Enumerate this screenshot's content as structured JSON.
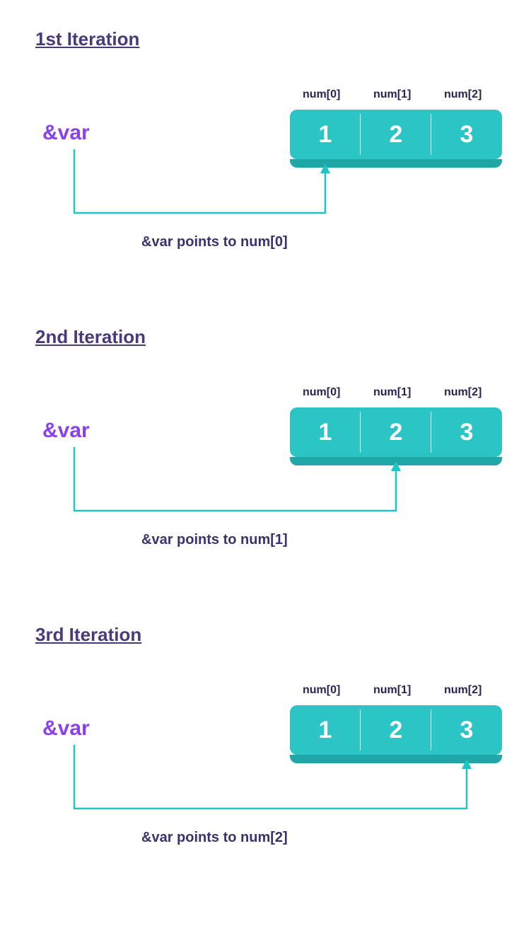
{
  "colors": {
    "accent": "#2bc5c5",
    "var": "#8a3ff0",
    "ink": "#3a3270"
  },
  "iterations": [
    {
      "title": "1st Iteration",
      "var_label": "&var",
      "cells": [
        {
          "label": "num[0]",
          "value": "1"
        },
        {
          "label": "num[1]",
          "value": "2"
        },
        {
          "label": "num[2]",
          "value": "3"
        }
      ],
      "caption": "&var points to num[0]",
      "target_index": 0
    },
    {
      "title": "2nd Iteration",
      "var_label": "&var",
      "cells": [
        {
          "label": "num[0]",
          "value": "1"
        },
        {
          "label": "num[1]",
          "value": "2"
        },
        {
          "label": "num[2]",
          "value": "3"
        }
      ],
      "caption": "&var points to num[1]",
      "target_index": 1
    },
    {
      "title": "3rd Iteration",
      "var_label": "&var",
      "cells": [
        {
          "label": "num[0]",
          "value": "1"
        },
        {
          "label": "num[1]",
          "value": "2"
        },
        {
          "label": "num[2]",
          "value": "3"
        }
      ],
      "caption": "&var points to num[2]",
      "target_index": 2
    }
  ]
}
